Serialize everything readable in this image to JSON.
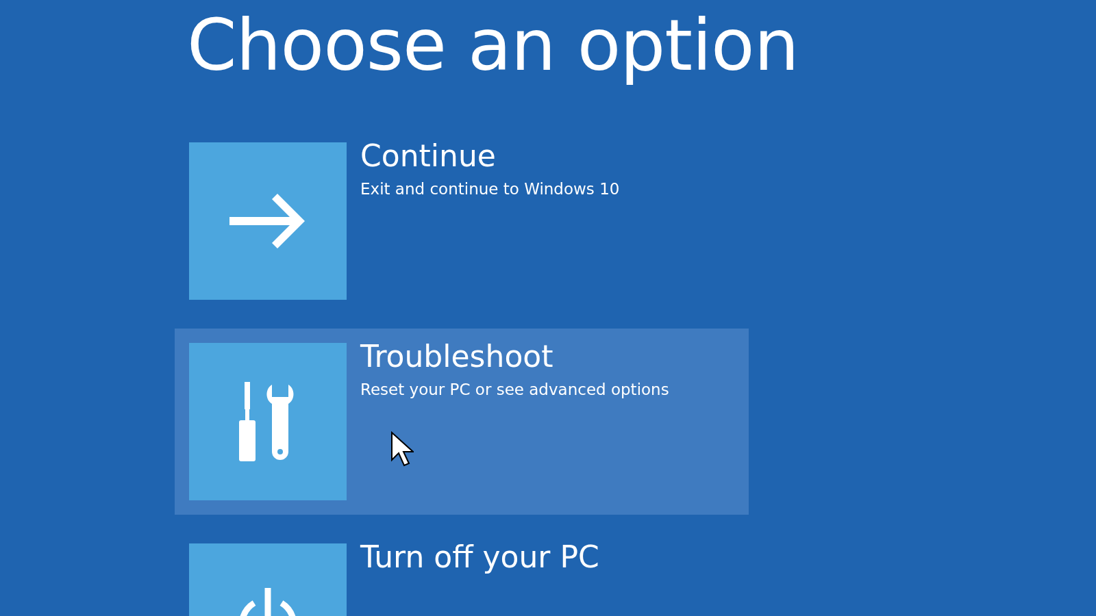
{
  "title": "Choose an option",
  "options": [
    {
      "kind": "arrow",
      "label": "Continue",
      "description": "Exit and continue to Windows 10",
      "selected": false
    },
    {
      "kind": "tools",
      "label": "Troubleshoot",
      "description": "Reset your PC or see advanced options",
      "selected": true
    },
    {
      "kind": "power",
      "label": "Turn off your PC",
      "selected": false
    }
  ]
}
